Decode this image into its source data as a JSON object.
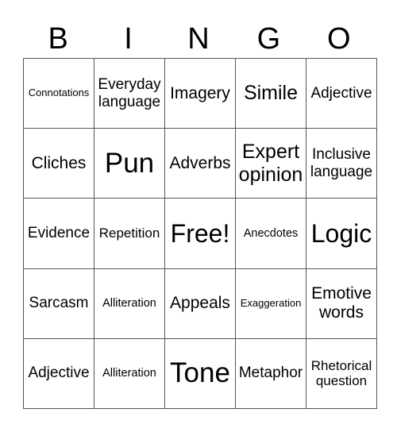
{
  "header": [
    "B",
    "I",
    "N",
    "G",
    "O"
  ],
  "rows": [
    [
      "Connotations",
      "Everyday\nlanguage",
      "Imagery",
      "Simile",
      "Adjective"
    ],
    [
      "Cliches",
      "Pun",
      "Adverbs",
      "Expert\nopinion",
      "Inclusive\nlanguage"
    ],
    [
      "Evidence",
      "Repetition",
      "Free!",
      "Anecdotes",
      "Logic"
    ],
    [
      "Sarcasm",
      "Alliteration",
      "Appeals",
      "Exaggeration",
      "Emotive\nwords"
    ],
    [
      "Adjective",
      "Alliteration",
      "Tone",
      "Metaphor",
      "Rhetorical\nquestion"
    ]
  ]
}
